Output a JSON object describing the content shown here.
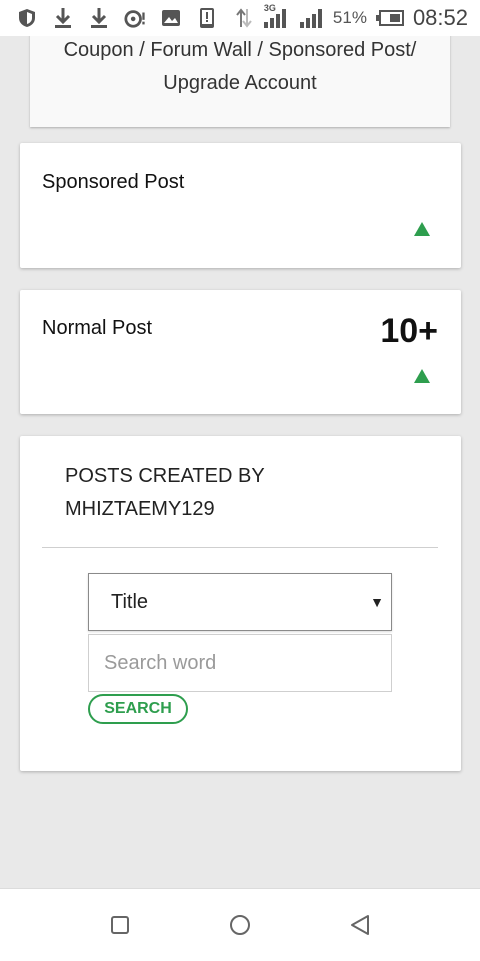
{
  "status_bar": {
    "battery_percent": "51%",
    "time": "08:52",
    "network_label": "3G",
    "icons": [
      "shield-icon",
      "download-icon",
      "download-icon",
      "speedometer-icon",
      "image-icon",
      "phone-alert-icon",
      "data-arrows-icon",
      "signal-icon",
      "signal-icon",
      "battery-icon"
    ]
  },
  "top_card": {
    "line1": "Coupon / Forum Wall / Sponsored Post/",
    "line2": "Upgrade Account"
  },
  "sponsored_card": {
    "title": "Sponsored Post"
  },
  "normal_card": {
    "title": "Normal Post",
    "count": "10+"
  },
  "posts_section": {
    "heading_line1": "POSTS CREATED BY",
    "heading_line2": "MHIZTAEMY129",
    "select_value": "Title",
    "select_options": [
      "Title"
    ],
    "search_placeholder": "Search word",
    "search_value": "",
    "search_button": "SEARCH"
  },
  "colors": {
    "accent_green": "#2e9e4e",
    "background": "#e9e9e9"
  }
}
